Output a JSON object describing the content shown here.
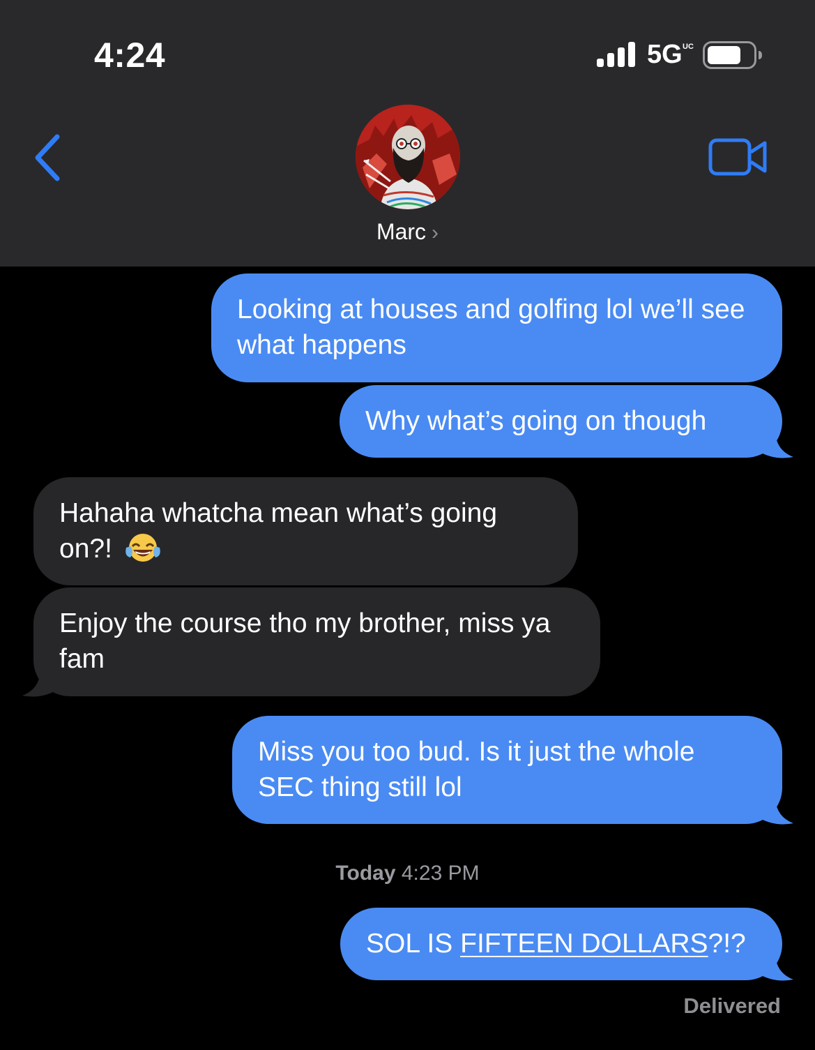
{
  "status_bar": {
    "time": "4:24",
    "network": "5G",
    "network_suffix": "UC",
    "signal_bars": 4,
    "battery_level": 0.75
  },
  "nav": {
    "back_icon": "chevron-left-icon",
    "video_icon": "video-camera-icon",
    "contact_name": "Marc",
    "contact_chevron": "›"
  },
  "messages": [
    {
      "direction": "outgoing",
      "text": "Looking at houses and golfing lol we’ll see what happens"
    },
    {
      "direction": "outgoing",
      "text": "Why what’s going on though"
    },
    {
      "direction": "incoming",
      "text": "Hahaha whatcha mean what’s going on?!",
      "emoji": "😂"
    },
    {
      "direction": "incoming",
      "text": "Enjoy the course tho my brother, miss ya fam"
    },
    {
      "direction": "outgoing",
      "text": "Miss you too bud. Is it just the whole SEC thing still lol"
    },
    {
      "direction": "outgoing",
      "text_prefix": "SOL IS ",
      "text_link": "FIFTEEN DOLLARS",
      "text_suffix": "?!?"
    }
  ],
  "timestamp": {
    "day": "Today",
    "time": "4:23 PM"
  },
  "delivery_status": "Delivered",
  "colors": {
    "outgoing_bubble": "#4a8bf3",
    "incoming_bubble": "#27272a",
    "accent": "#2f7cf6",
    "header_bg": "#29292b"
  }
}
